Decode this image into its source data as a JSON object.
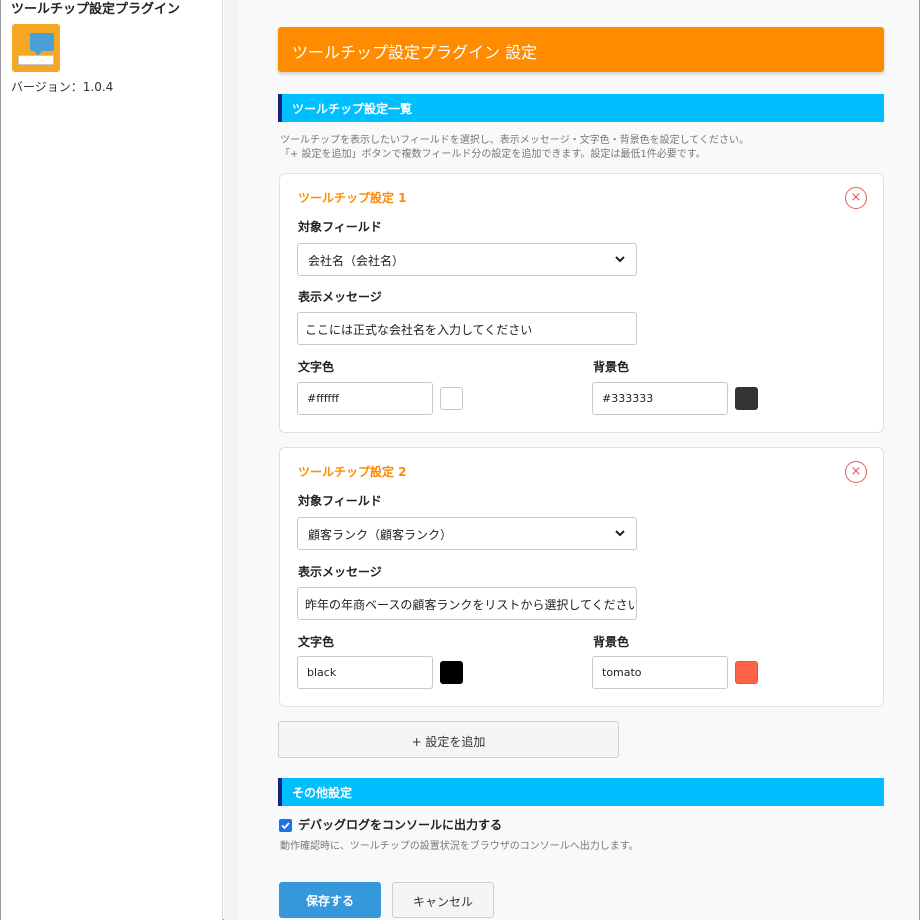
{
  "sidebar": {
    "plugin_title": "ツールチップ設定プラグイン",
    "version": "バージョン：1.0.4"
  },
  "header": {
    "title": "ツールチップ設定プラグイン 設定"
  },
  "tooltip_section": {
    "title": "ツールチップ設定一覧",
    "desc_line1": "ツールチップを表示したいフィールドを選択し、表示メッセージ・文字色・背景色を設定してください。",
    "desc_line2": "「+ 設定を追加」ボタンで複数フィールド分の設定を追加できます。設定は最低1件必要です。"
  },
  "labels": {
    "field": "対象フィールド",
    "message": "表示メッセージ",
    "text_color": "文字色",
    "bg_color": "背景色",
    "remove": "×"
  },
  "settings": [
    {
      "title": "ツールチップ設定 1",
      "field_value": "会社名（会社名）",
      "message_value": "ここには正式な会社名を入力してください",
      "text_color_value": "#ffffff",
      "text_color_swatch": "#ffffff",
      "bg_color_value": "#333333",
      "bg_color_swatch": "#333333"
    },
    {
      "title": "ツールチップ設定 2",
      "field_value": "顧客ランク（顧客ランク）",
      "message_value": "昨年の年商ベースの顧客ランクをリストから選択してください",
      "text_color_value": "black",
      "text_color_swatch": "#000000",
      "bg_color_value": "tomato",
      "bg_color_swatch": "#ff6347"
    }
  ],
  "add_button": "+ 設定を追加",
  "other_section": {
    "title": "その他設定",
    "debug_label": "デバッグログをコンソールに出力する",
    "debug_checked": true,
    "debug_desc": "動作確認時に、ツールチップの設置状況をブラウザのコンソールへ出力します。"
  },
  "actions": {
    "save": "保存する",
    "cancel": "キャンセル"
  },
  "colors": {
    "header_orange": "#ff8c00",
    "section_cyan": "#00bfff",
    "section_accent": "#1a237e",
    "save_blue": "#3498db",
    "close_red": "#e25c5c"
  }
}
